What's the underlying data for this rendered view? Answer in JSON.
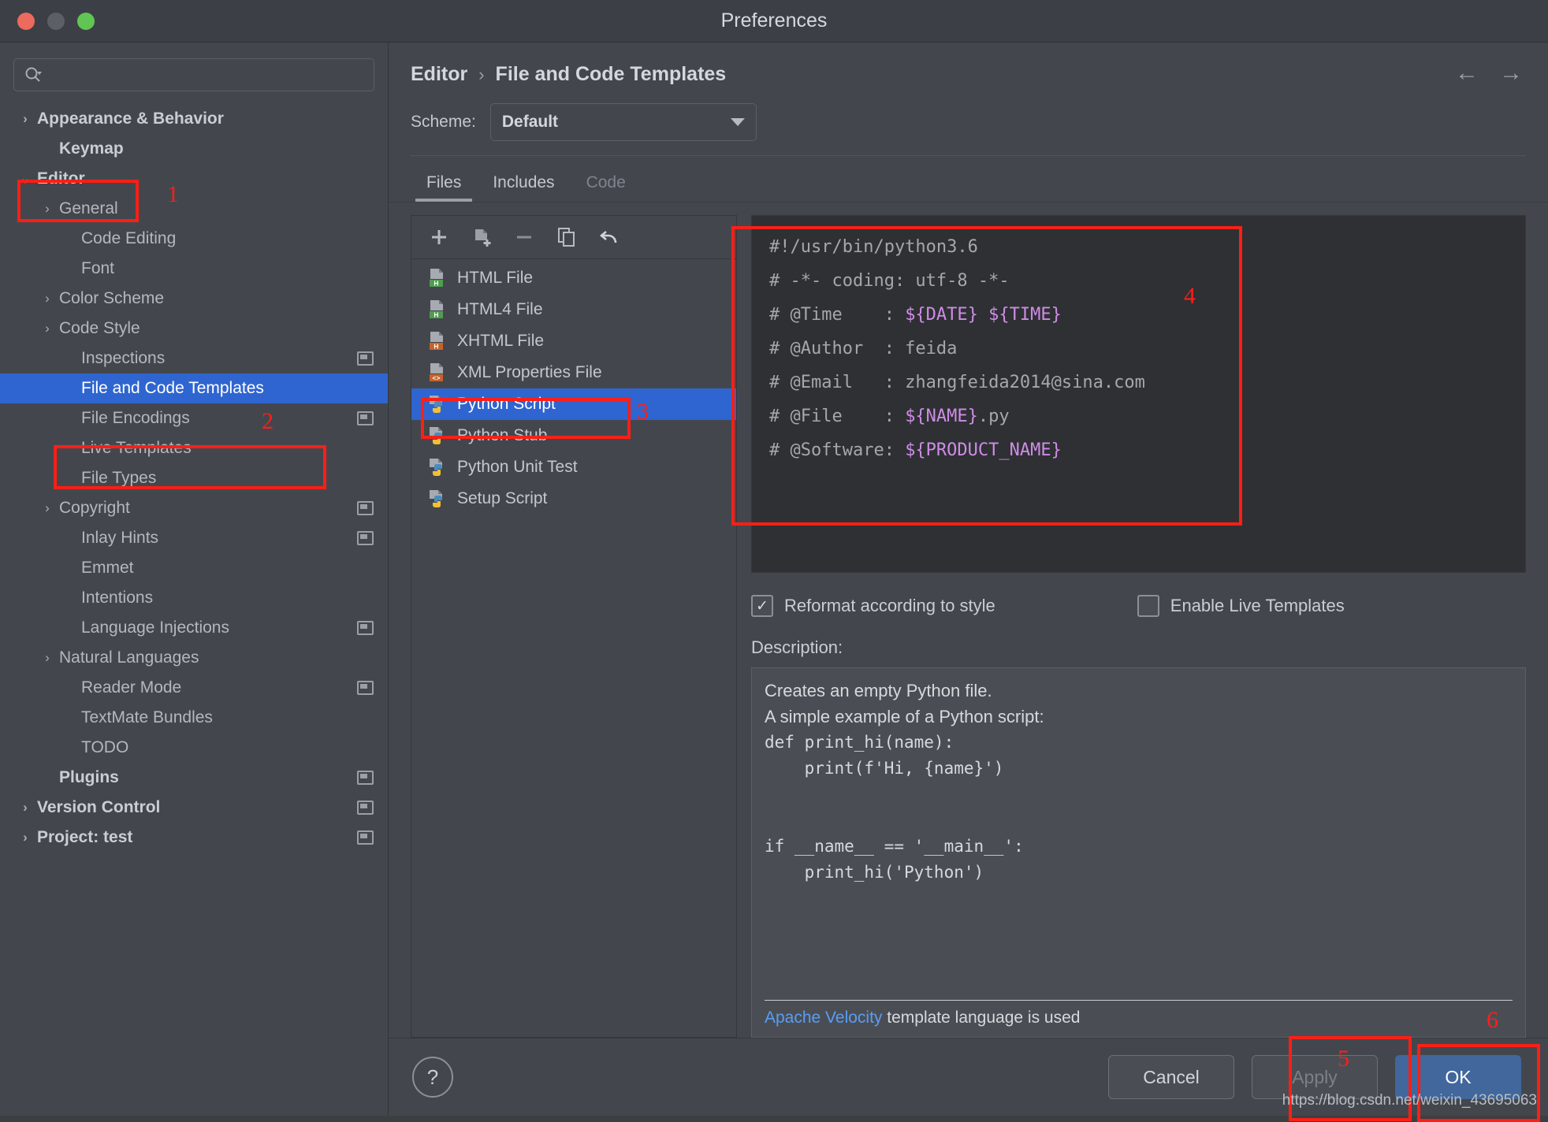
{
  "window": {
    "title": "Preferences",
    "traffic_lights": [
      "close-button",
      "minimize-button",
      "maximize-button"
    ]
  },
  "sidebar": {
    "search": {
      "value": "",
      "placeholder": ""
    },
    "items": [
      {
        "label": "Appearance & Behavior",
        "arrow": "›",
        "bold": true,
        "indent": 0,
        "badge": false,
        "selected": false
      },
      {
        "label": "Keymap",
        "arrow": "",
        "bold": true,
        "indent": 1,
        "badge": false,
        "selected": false
      },
      {
        "label": "Editor",
        "arrow": "⌄",
        "bold": true,
        "indent": 0,
        "badge": false,
        "selected": false
      },
      {
        "label": "General",
        "arrow": "›",
        "bold": false,
        "indent": 1,
        "badge": false,
        "selected": false
      },
      {
        "label": "Code Editing",
        "arrow": "",
        "bold": false,
        "indent": 2,
        "badge": false,
        "selected": false
      },
      {
        "label": "Font",
        "arrow": "",
        "bold": false,
        "indent": 2,
        "badge": false,
        "selected": false
      },
      {
        "label": "Color Scheme",
        "arrow": "›",
        "bold": false,
        "indent": 1,
        "badge": false,
        "selected": false
      },
      {
        "label": "Code Style",
        "arrow": "›",
        "bold": false,
        "indent": 1,
        "badge": false,
        "selected": false
      },
      {
        "label": "Inspections",
        "arrow": "",
        "bold": false,
        "indent": 2,
        "badge": true,
        "selected": false
      },
      {
        "label": "File and Code Templates",
        "arrow": "",
        "bold": false,
        "indent": 2,
        "badge": false,
        "selected": true
      },
      {
        "label": "File Encodings",
        "arrow": "",
        "bold": false,
        "indent": 2,
        "badge": true,
        "selected": false
      },
      {
        "label": "Live Templates",
        "arrow": "",
        "bold": false,
        "indent": 2,
        "badge": false,
        "selected": false
      },
      {
        "label": "File Types",
        "arrow": "",
        "bold": false,
        "indent": 2,
        "badge": false,
        "selected": false
      },
      {
        "label": "Copyright",
        "arrow": "›",
        "bold": false,
        "indent": 1,
        "badge": true,
        "selected": false
      },
      {
        "label": "Inlay Hints",
        "arrow": "",
        "bold": false,
        "indent": 2,
        "badge": true,
        "selected": false
      },
      {
        "label": "Emmet",
        "arrow": "",
        "bold": false,
        "indent": 2,
        "badge": false,
        "selected": false
      },
      {
        "label": "Intentions",
        "arrow": "",
        "bold": false,
        "indent": 2,
        "badge": false,
        "selected": false
      },
      {
        "label": "Language Injections",
        "arrow": "",
        "bold": false,
        "indent": 2,
        "badge": true,
        "selected": false
      },
      {
        "label": "Natural Languages",
        "arrow": "›",
        "bold": false,
        "indent": 1,
        "badge": false,
        "selected": false
      },
      {
        "label": "Reader Mode",
        "arrow": "",
        "bold": false,
        "indent": 2,
        "badge": true,
        "selected": false
      },
      {
        "label": "TextMate Bundles",
        "arrow": "",
        "bold": false,
        "indent": 2,
        "badge": false,
        "selected": false
      },
      {
        "label": "TODO",
        "arrow": "",
        "bold": false,
        "indent": 2,
        "badge": false,
        "selected": false
      },
      {
        "label": "Plugins",
        "arrow": "",
        "bold": true,
        "indent": 1,
        "badge": true,
        "selected": false
      },
      {
        "label": "Version Control",
        "arrow": "›",
        "bold": true,
        "indent": 0,
        "badge": true,
        "selected": false
      },
      {
        "label": "Project: test",
        "arrow": "›",
        "bold": true,
        "indent": 0,
        "badge": true,
        "selected": false
      }
    ]
  },
  "main": {
    "breadcrumb": {
      "parent": "Editor",
      "separator": "›",
      "current": "File and Code Templates"
    },
    "nav": {
      "back": "←",
      "forward": "→"
    },
    "scheme": {
      "label": "Scheme:",
      "value": "Default"
    },
    "tabs": [
      {
        "label": "Files",
        "state": "active"
      },
      {
        "label": "Includes",
        "state": "normal"
      },
      {
        "label": "Code",
        "state": "disabled"
      }
    ],
    "toolbar": [
      {
        "name": "add-template-button",
        "glyph": "+"
      },
      {
        "name": "add-child-template-button",
        "glyph": "file-plus"
      },
      {
        "name": "remove-template-button",
        "glyph": "−"
      },
      {
        "name": "copy-template-button",
        "glyph": "copy"
      },
      {
        "name": "reset-template-button",
        "glyph": "undo"
      }
    ],
    "file_list": [
      {
        "label": "HTML File",
        "icon": "html-file-icon",
        "badge_text": "H",
        "badge_color": "#4f9d4f",
        "selected": false
      },
      {
        "label": "HTML4 File",
        "icon": "html4-file-icon",
        "badge_text": "H",
        "badge_color": "#4f9d4f",
        "selected": false
      },
      {
        "label": "XHTML File",
        "icon": "xhtml-file-icon",
        "badge_text": "H",
        "badge_color": "#c5632b",
        "selected": false
      },
      {
        "label": "XML Properties File",
        "icon": "xml-properties-file-icon",
        "badge_text": "<>",
        "badge_color": "#c5632b",
        "selected": false
      },
      {
        "label": "Python Script",
        "icon": "python-file-icon",
        "badge_text": "",
        "badge_color": "",
        "selected": true
      },
      {
        "label": "Python Stub",
        "icon": "python-file-icon",
        "badge_text": "",
        "badge_color": "",
        "selected": false
      },
      {
        "label": "Python Unit Test",
        "icon": "python-file-icon",
        "badge_text": "",
        "badge_color": "",
        "selected": false
      },
      {
        "label": "Setup Script",
        "icon": "python-file-icon",
        "badge_text": "",
        "badge_color": "",
        "selected": false
      }
    ],
    "code_lines": [
      [
        {
          "t": "#!/usr/bin/python3.6",
          "k": "plain"
        }
      ],
      [
        {
          "t": "# -*- coding: utf-8 -*-",
          "k": "plain"
        }
      ],
      [
        {
          "t": "# @Time    : ",
          "k": "plain"
        },
        {
          "t": "${DATE} ${TIME}",
          "k": "var"
        }
      ],
      [
        {
          "t": "# @Author  : feida",
          "k": "plain"
        }
      ],
      [
        {
          "t": "# @Email   : zhangfeida2014@sina.com",
          "k": "plain"
        }
      ],
      [
        {
          "t": "# @File    : ",
          "k": "plain"
        },
        {
          "t": "${NAME}",
          "k": "var"
        },
        {
          "t": ".py",
          "k": "plain"
        }
      ],
      [
        {
          "t": "# @Software: ",
          "k": "plain"
        },
        {
          "t": "${PRODUCT_NAME}",
          "k": "var"
        }
      ]
    ],
    "checkboxes": [
      {
        "label": "Reformat according to style",
        "checked": true,
        "mark": "✓"
      },
      {
        "label": "Enable Live Templates",
        "checked": false,
        "mark": ""
      }
    ],
    "description": {
      "label": "Description:",
      "lines": [
        {
          "text": "Creates an empty Python file.",
          "mono": false
        },
        {
          "text": "A simple example of a Python script:",
          "mono": false
        },
        {
          "text": "def print_hi(name):",
          "mono": true
        },
        {
          "text": "    print(f'Hi, {name}')",
          "mono": true
        },
        {
          "text": " ",
          "mono": true
        },
        {
          "text": " ",
          "mono": true
        },
        {
          "text": "if __name__ == '__main__':",
          "mono": true
        },
        {
          "text": "    print_hi('Python')",
          "mono": true
        }
      ],
      "footer_link": "Apache Velocity",
      "footer_rest": " template language is used"
    }
  },
  "footer": {
    "help_glyph": "?",
    "buttons": [
      {
        "label": "Cancel",
        "state": "normal",
        "name": "cancel-button"
      },
      {
        "label": "Apply",
        "state": "disabled",
        "name": "apply-button"
      },
      {
        "label": "OK",
        "state": "primary",
        "name": "ok-button"
      }
    ]
  },
  "annotations": [
    {
      "num": "1"
    },
    {
      "num": "2"
    },
    {
      "num": "3"
    },
    {
      "num": "4"
    },
    {
      "num": "5"
    },
    {
      "num": "6"
    }
  ],
  "watermark": "https://blog.csdn.net/weixin_43695063"
}
